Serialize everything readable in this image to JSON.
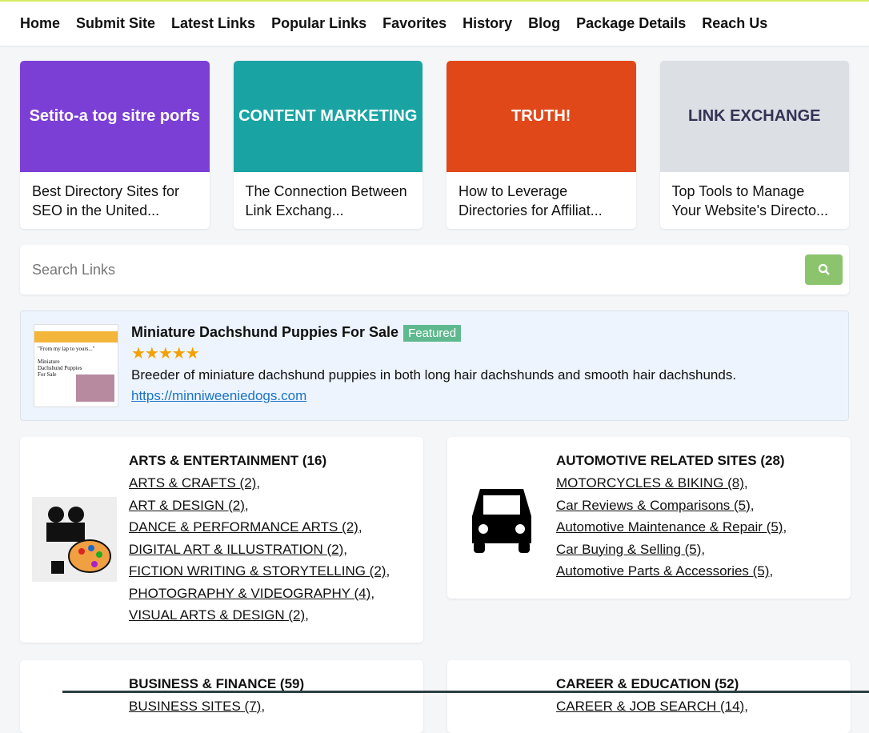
{
  "nav": [
    "Home",
    "Submit Site",
    "Latest Links",
    "Popular Links",
    "Favorites",
    "History",
    "Blog",
    "Package Details",
    "Reach Us"
  ],
  "posts": [
    {
      "title": "Best Directory Sites for SEO in the United...",
      "image_text": "Setito-a tog sitre porfs",
      "color": "#7b3fd6"
    },
    {
      "title": "The Connection Between Link Exchang...",
      "image_text": "CONTENT MARKETING",
      "color": "#1aa3a3"
    },
    {
      "title": "How to Leverage Directories for Affiliat...",
      "image_text": "TRUTH!",
      "color": "#e0481a"
    },
    {
      "title": "Top Tools to Manage Your Website's Directo...",
      "image_text": "LINK EXCHANGE",
      "color": "#dcdfe3"
    }
  ],
  "search": {
    "placeholder": "Search Links"
  },
  "featured": {
    "title": "Miniature Dachshund Puppies For Sale",
    "badge": "Featured",
    "stars": "★★★★★",
    "rating": 5,
    "description": "Breeder of miniature dachshund puppies in both long hair dachshunds and smooth hair dachshunds.",
    "url": "https://minniweeniedogs.com"
  },
  "categories": [
    {
      "name": "ARTS & ENTERTAINMENT (16)",
      "icon": "film-camera-palette-icon",
      "subs": [
        "ARTS & CRAFTS (2)",
        "ART & DESIGN (2)",
        "DANCE & PERFORMANCE ARTS (2)",
        "DIGITAL ART & ILLUSTRATION (2)",
        "FICTION WRITING & STORYTELLING (2)",
        "PHOTOGRAPHY & VIDEOGRAPHY (4)",
        "VISUAL ARTS & DESIGN (2)"
      ]
    },
    {
      "name": "AUTOMOTIVE RELATED SITES (28)",
      "icon": "car-icon",
      "subs": [
        "MOTORCYCLES & BIKING (8)",
        "Car Reviews & Comparisons (5)",
        "Automotive Maintenance & Repair (5)",
        "Car Buying & Selling (5)",
        "Automotive Parts & Accessories (5)"
      ]
    },
    {
      "name": "BUSINESS & FINANCE (59)",
      "icon": "business-icon",
      "subs": [
        "BUSINESS SITES (7)"
      ]
    },
    {
      "name": "CAREER & EDUCATION (52)",
      "icon": "career-icon",
      "subs": [
        "CAREER & JOB SEARCH (14)"
      ]
    }
  ]
}
